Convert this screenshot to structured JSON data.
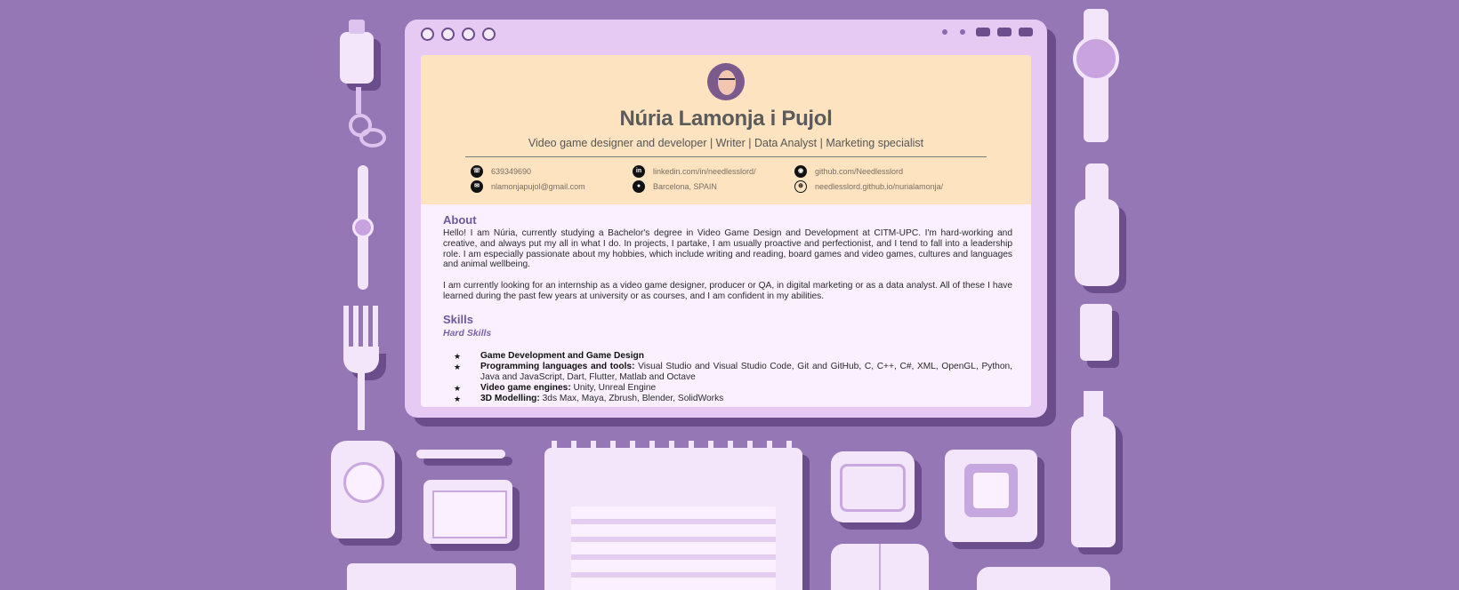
{
  "profile": {
    "name": "Núria Lamonja i Pujol",
    "subtitle": "Video game designer and developer | Writer | Data Analyst | Marketing specialist",
    "contacts": [
      {
        "icon": "phone-icon",
        "text": "639349690"
      },
      {
        "icon": "linkedin-icon",
        "text": "linkedin.com/in/needlesslord/"
      },
      {
        "icon": "github-icon",
        "text": "github.com/Needlesslord"
      },
      {
        "icon": "email-icon",
        "text": "nlamonjapujol@gmail.com"
      },
      {
        "icon": "location-icon",
        "text": "Barcelona, SPAIN"
      },
      {
        "icon": "globe-icon",
        "text": "needlesslord.github.io/nurialamonja/"
      }
    ]
  },
  "about": {
    "heading": "About",
    "paragraphs": [
      "Hello! I am Núria, currently studying a Bachelor's degree in Video Game Design and Development at CITM-UPC. I'm hard-working and creative, and always put my all in what I do. In projects, I partake, I am usually proactive and perfectionist, and I tend to fall into a leadership role. I am especially passionate about my hobbies, which include writing and reading, board games and video games, cultures and languages and animal wellbeing.",
      "I am currently looking for an internship as a video game designer, producer or QA, in digital marketing or as a data analyst. All of these I have learned during the past few years at university or as courses, and I am confident in my abilities."
    ]
  },
  "skills": {
    "heading": "Skills",
    "subheading": "Hard Skills",
    "items": [
      {
        "label": "Game Development and Game Design",
        "detail": ""
      },
      {
        "label": "Programming languages and tools:",
        "detail": " Visual Studio and Visual Studio Code, Git and GitHub, C, C++, C#, XML, OpenGL, Python, Java and JavaScript, Dart, Flutter, Matlab and Octave"
      },
      {
        "label": "Video game engines:",
        "detail": " Unity, Unreal Engine"
      },
      {
        "label": "3D Modelling:",
        "detail": " 3ds Max, Maya, Zbrush, Blender, SolidWorks"
      }
    ]
  },
  "colors": {
    "background": "#9677b5",
    "header_band": "#fde3c0",
    "accent": "#6e57a2"
  }
}
